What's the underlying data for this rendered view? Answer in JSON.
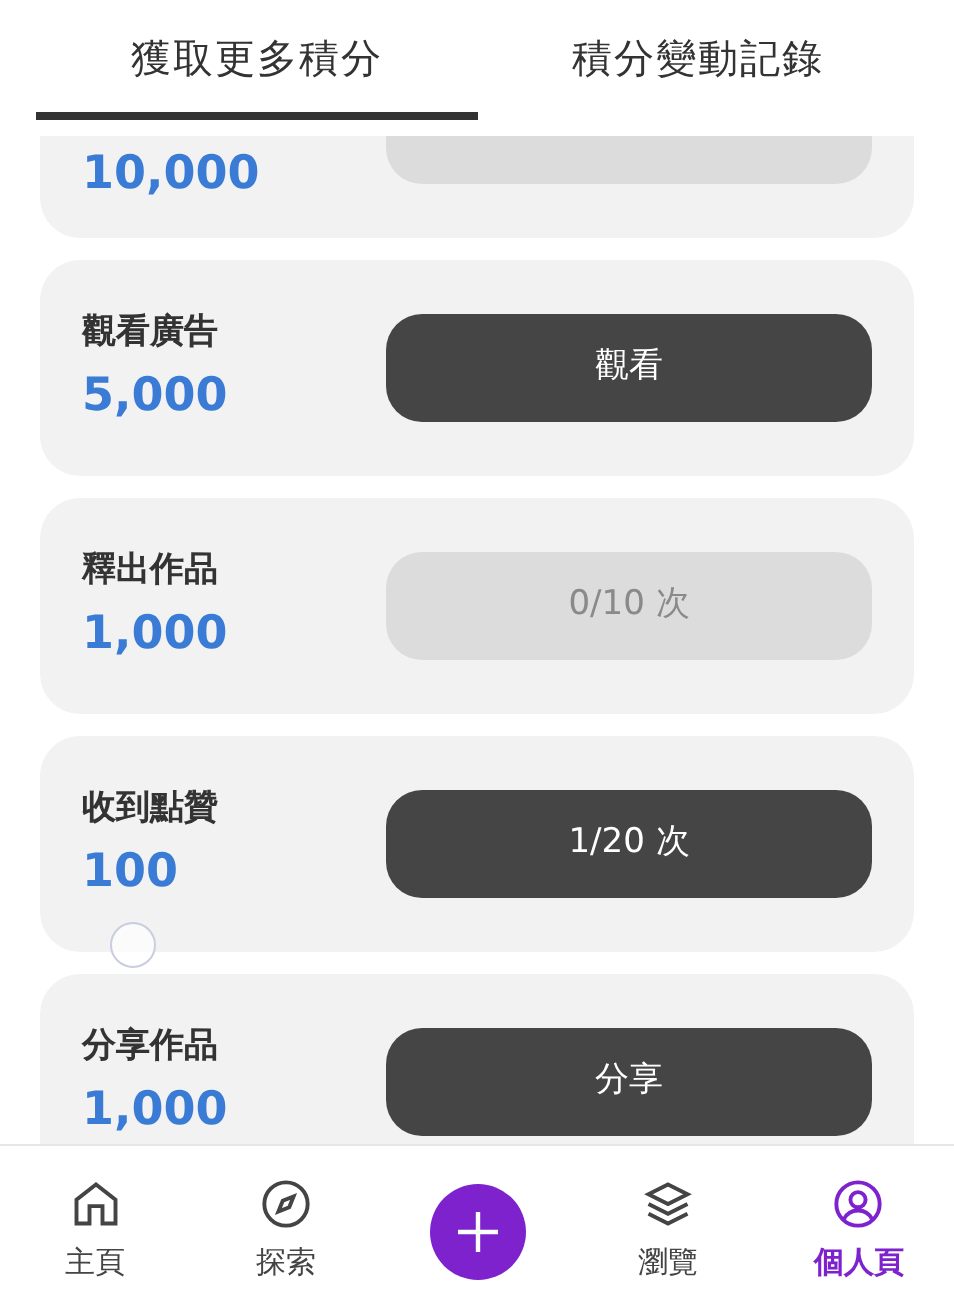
{
  "tabs": [
    {
      "label": "獲取更多積分",
      "selected": true
    },
    {
      "label": "積分變動記錄",
      "selected": false
    }
  ],
  "tasks": [
    {
      "points": "10,000",
      "button": {
        "disabled": true
      }
    },
    {
      "title": "觀看廣告",
      "points": "5,000",
      "button": {
        "label": "觀看",
        "disabled": false
      }
    },
    {
      "title": "釋出作品",
      "points": "1,000",
      "button": {
        "label": "0/10 次",
        "disabled": true
      }
    },
    {
      "title": "收到點贊",
      "points": "100",
      "button": {
        "label": "1/20 次",
        "disabled": false
      }
    },
    {
      "title": "分享作品",
      "points": "1,000",
      "button": {
        "label": "分享",
        "disabled": false
      }
    }
  ],
  "bottom_nav": [
    {
      "kind": "home",
      "label": "主頁",
      "selected": false
    },
    {
      "kind": "explore",
      "label": "探索",
      "selected": false
    },
    {
      "kind": "add",
      "selected": false
    },
    {
      "kind": "browse",
      "label": "瀏覽",
      "selected": false
    },
    {
      "kind": "profile",
      "label": "個人頁",
      "selected": true
    }
  ]
}
